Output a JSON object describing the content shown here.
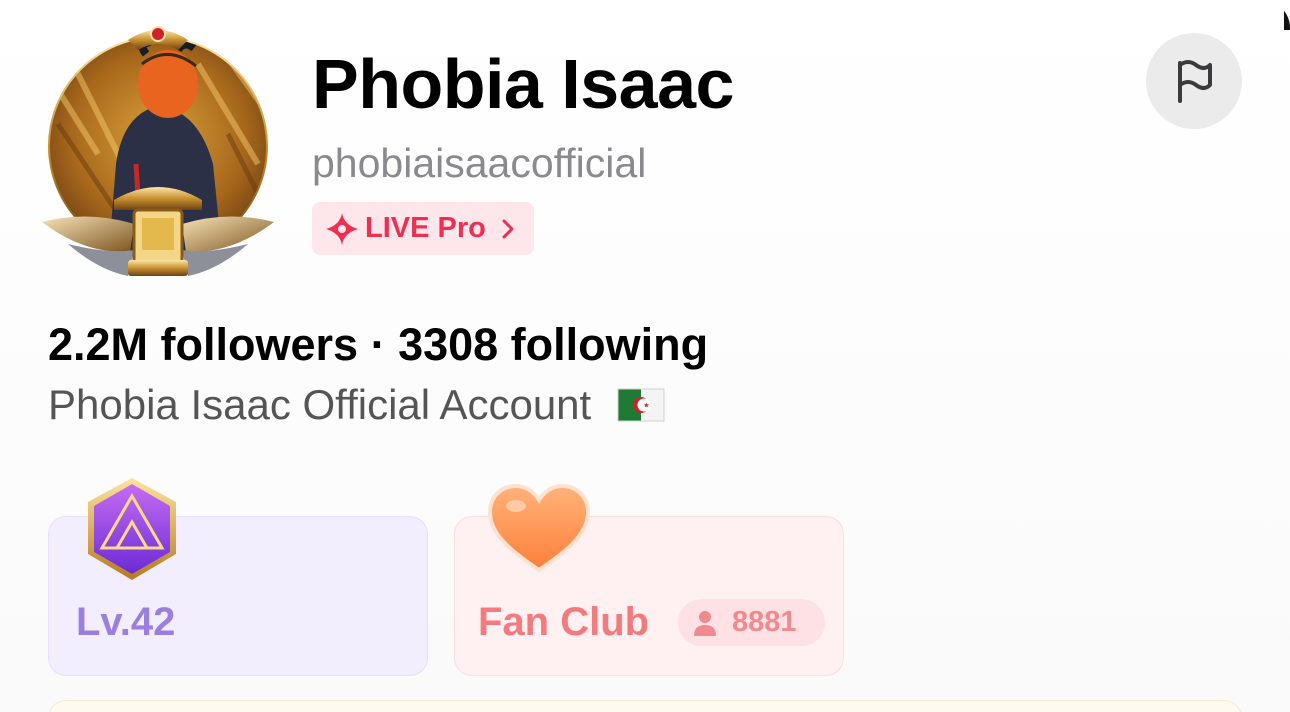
{
  "profile": {
    "display_name": "Phobia Isaac",
    "username": "phobiaisaacofficial",
    "live_pro_label": "LIVE Pro",
    "stats_text": "2.2M followers · 3308 following",
    "bio": "Phobia Isaac Official Account",
    "bio_flag_icon": "algeria-flag-icon"
  },
  "cards": {
    "level_label": "Lv.42",
    "fan_club_label": "Fan Club",
    "fan_club_members": "8881"
  },
  "colors": {
    "live_pro_accent": "#f02e52",
    "level_accent": "#9b7fe0",
    "fan_club_accent": "#f47a7e"
  }
}
